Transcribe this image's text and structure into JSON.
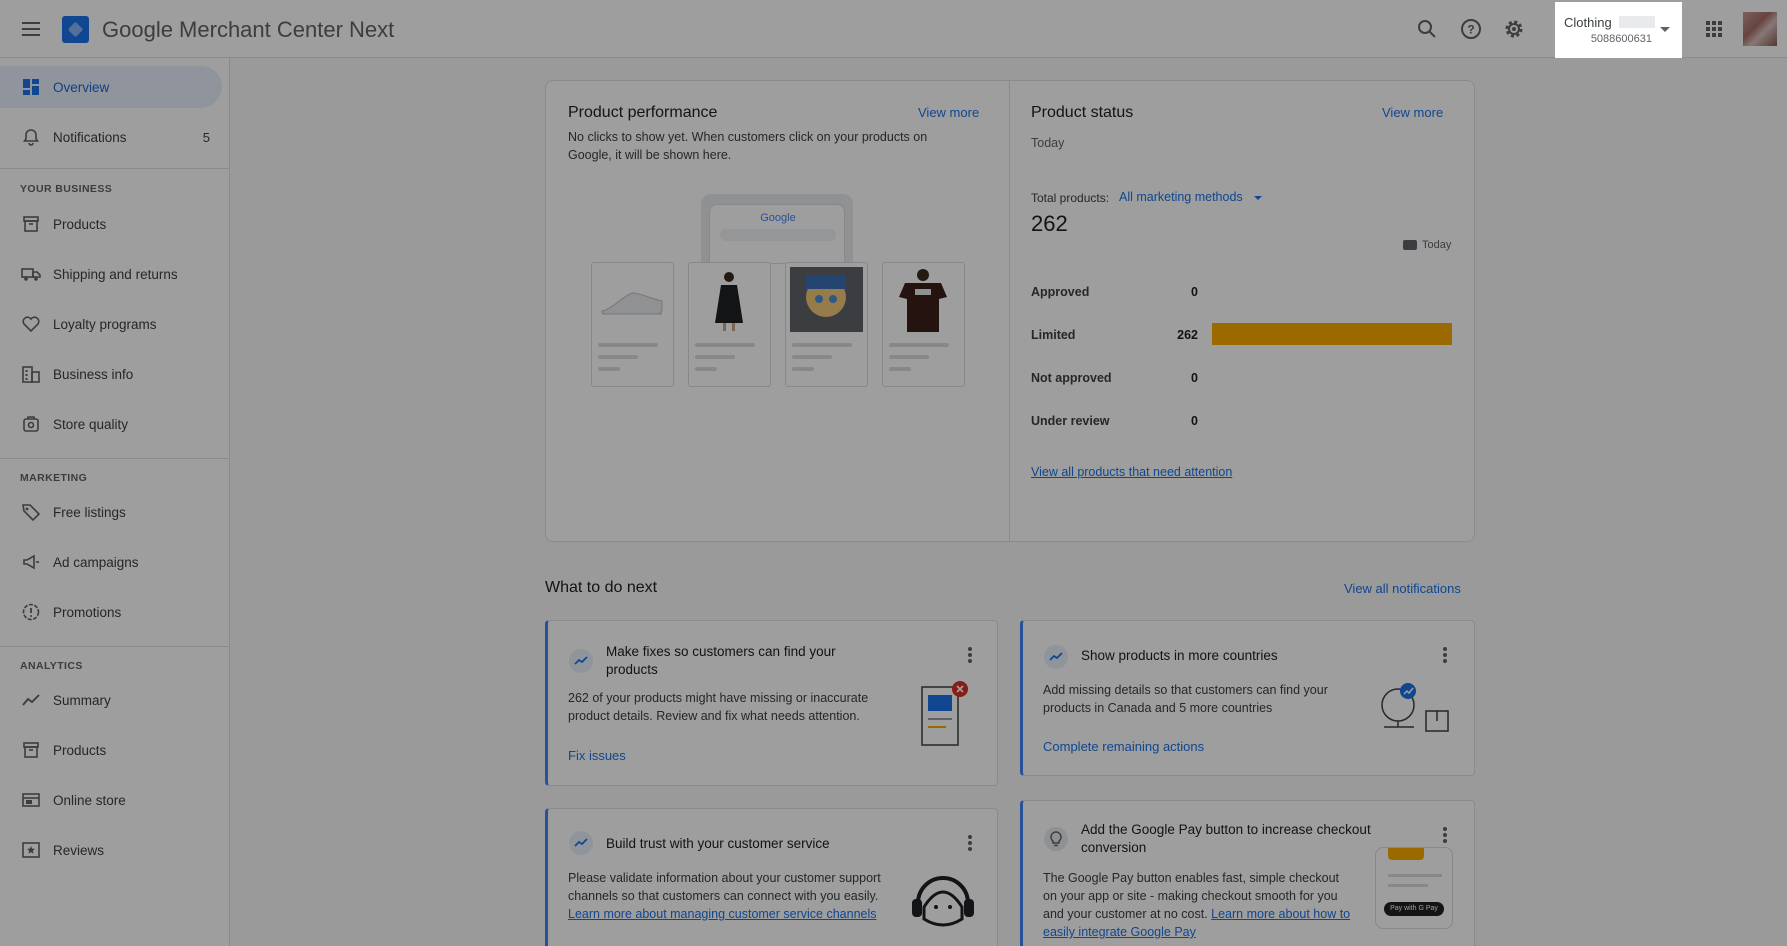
{
  "header": {
    "app_name": "Google Merchant Center Next",
    "account_name": "Clothing",
    "account_id": "5088600631"
  },
  "sidebar": {
    "items_top": [
      {
        "label": "Overview",
        "icon": "dashboard-icon"
      },
      {
        "label": "Notifications",
        "icon": "bell-icon",
        "count": "5"
      }
    ],
    "section_business": "YOUR BUSINESS",
    "business": [
      {
        "label": "Products",
        "icon": "archive-icon"
      },
      {
        "label": "Shipping and returns",
        "icon": "truck-icon"
      },
      {
        "label": "Loyalty programs",
        "icon": "heart-tag-icon"
      },
      {
        "label": "Business info",
        "icon": "building-icon"
      },
      {
        "label": "Store quality",
        "icon": "store-badge-icon"
      }
    ],
    "section_marketing": "MARKETING",
    "marketing": [
      {
        "label": "Free listings",
        "icon": "tag-icon"
      },
      {
        "label": "Ad campaigns",
        "icon": "megaphone-icon"
      },
      {
        "label": "Promotions",
        "icon": "promotion-badge-icon"
      }
    ],
    "section_analytics": "ANALYTICS",
    "analytics": [
      {
        "label": "Summary",
        "icon": "trend-line-icon"
      },
      {
        "label": "Products",
        "icon": "archive-icon"
      },
      {
        "label": "Online store",
        "icon": "web-icon"
      },
      {
        "label": "Reviews",
        "icon": "star-box-icon"
      }
    ]
  },
  "performance": {
    "title": "Product performance",
    "view_more": "View more",
    "empty_text": "No clicks to show yet. When customers click on your products on Google, it will be shown here.",
    "google_word": "Google"
  },
  "status": {
    "title": "Product status",
    "view_more": "View more",
    "date": "Today",
    "total_label": "Total products:",
    "methods_label": "All marketing methods",
    "total": "262",
    "legend": "Today",
    "rows": [
      {
        "label": "Approved",
        "value": "0",
        "fraction": 0
      },
      {
        "label": "Limited",
        "value": "262",
        "fraction": 1.0
      },
      {
        "label": "Not approved",
        "value": "0",
        "fraction": 0
      },
      {
        "label": "Under review",
        "value": "0",
        "fraction": 0
      }
    ],
    "bar_color": "#f9ab00",
    "attention_link": "View all products that need attention"
  },
  "next": {
    "title": "What to do next",
    "view_all": "View all notifications",
    "cards": [
      {
        "title": "Make fixes so customers can find your products",
        "body": "262 of your products might have missing or inaccurate product details. Review and fix what needs attention.",
        "action": "Fix issues"
      },
      {
        "title": "Show products in more countries",
        "body": "Add missing details so that customers can find your products in Canada and 5 more countries",
        "action": "Complete remaining actions"
      },
      {
        "title": "Build trust with your customer service",
        "body": "Please validate information about your customer support channels so that customers can connect with you easily.",
        "link": "Learn more about managing customer service channels"
      },
      {
        "title": "Add the Google Pay button to increase checkout conversion",
        "body": "The Google Pay button enables fast, simple checkout on your app or site - making checkout smooth for you and your customer at no cost.",
        "link": "Learn more about how to easily integrate Google Pay",
        "button_text": "Pay with G Pay"
      }
    ]
  }
}
